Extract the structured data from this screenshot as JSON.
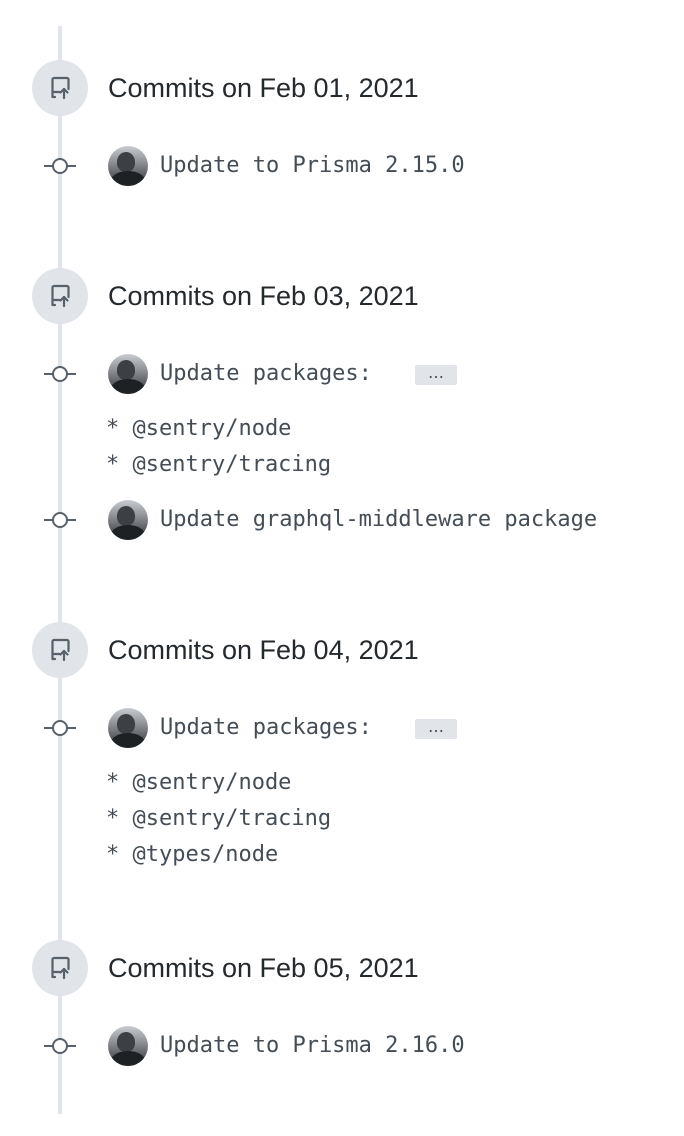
{
  "groups": [
    {
      "title": "Commits on Feb 01, 2021",
      "commits": [
        {
          "message": "Update to Prisma 2.15.0"
        }
      ]
    },
    {
      "title": "Commits on Feb 03, 2021",
      "commits": [
        {
          "message": "Update packages:",
          "ellipsis_label": "…",
          "body_lines": [
            "* @sentry/node",
            "* @sentry/tracing"
          ]
        },
        {
          "message": "Update graphql-middleware package"
        }
      ]
    },
    {
      "title": "Commits on Feb 04, 2021",
      "commits": [
        {
          "message": "Update packages:",
          "ellipsis_label": "…",
          "body_lines": [
            "* @sentry/node",
            "* @sentry/tracing",
            "* @types/node"
          ]
        }
      ]
    },
    {
      "title": "Commits on Feb 05, 2021",
      "commits": [
        {
          "message": "Update to Prisma 2.16.0"
        }
      ]
    }
  ],
  "icons": {
    "group_icon": "repo-push-icon",
    "commit_icon": "git-commit-icon",
    "avatar": "author-avatar"
  },
  "colors": {
    "rail": "#e1e4e8",
    "text": "#24292e",
    "muted": "#444d56"
  }
}
